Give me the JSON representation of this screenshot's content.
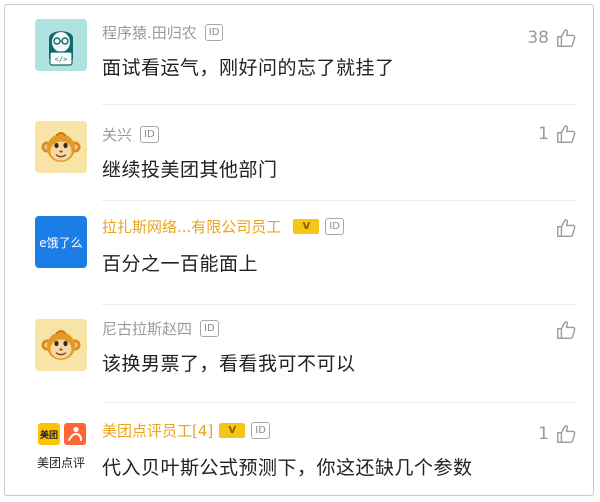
{
  "comments": [
    {
      "username": "程序猿.田归农",
      "id_badge": "ID",
      "text": "面试看运气，刚好问的忘了就挂了",
      "likes": "38",
      "avatar_icon": "programmer-avatar-icon"
    },
    {
      "username": "关兴",
      "id_badge": "ID",
      "text": "继续投美团其他部门",
      "likes": "1",
      "avatar_icon": "monkey-avatar-icon"
    },
    {
      "username": "拉扎斯网络...有限公司员工",
      "v_badge": "V",
      "id_badge": "ID",
      "text": "百分之一百能面上",
      "likes": "",
      "avatar_text": "e饿了么",
      "avatar_color": "#1a7ee6"
    },
    {
      "username": "尼古拉斯赵四",
      "id_badge": "ID",
      "text": "该换男票了，看看我可不可以",
      "likes": "",
      "avatar_icon": "monkey-avatar-icon"
    },
    {
      "username": "美团点评员工[4]",
      "v_badge": "V",
      "id_badge": "ID",
      "text": "代入贝叶斯公式预测下，你这还缺几个参数",
      "likes": "1",
      "avatar_tile_left": "美团",
      "avatar_caption": "美团点评"
    }
  ],
  "colors": {
    "username_gray": "#9a9a9a",
    "employee_gold": "#e8a51c",
    "eleme_blue": "#1a7ee6",
    "meituan_yellow": "#ffc300",
    "dianping_orange": "#ff6633"
  }
}
